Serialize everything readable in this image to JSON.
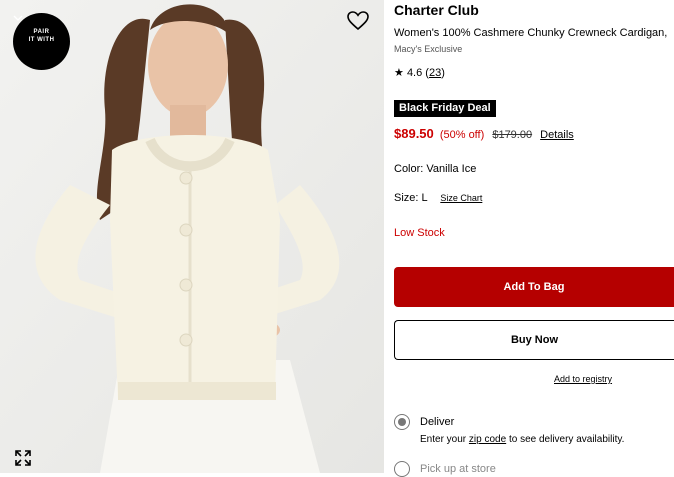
{
  "pair_badge": {
    "line1": "PAIR",
    "line2": "IT WITH"
  },
  "icons": {
    "heart": "heart-outline-icon",
    "expand": "expand-icon",
    "chevron": "chevron-down-icon",
    "star": "star-icon"
  },
  "product": {
    "brand": "Charter Club",
    "name": "Women's 100% Cashmere Chunky Crewneck Cardigan,",
    "exclusive": "Macy's Exclusive",
    "rating": "4.6",
    "review_count": "23",
    "deal_badge": "Black Friday Deal",
    "sale_price": "$89.50",
    "discount": "(50% off)",
    "original_price": "$179.00",
    "details_link": "Details",
    "color_label": "Color:",
    "color_value": "Vanilla Ice",
    "size_label": "Size:",
    "size_value": "L",
    "size_chart_link": "Size Chart",
    "stock_status": "Low Stock"
  },
  "actions": {
    "add_to_bag": "Add To Bag",
    "buy_now": "Buy Now",
    "add_to_registry": "Add to registry"
  },
  "fulfillment": {
    "deliver_label": "Deliver",
    "deliver_selected": true,
    "deliver_sub_prefix": "Enter your",
    "zip_link": "zip code",
    "deliver_sub_suffix": "to see delivery availability.",
    "pickup_label": "Pick up at store",
    "pickup_selected": false
  },
  "colors": {
    "accent_red": "#cc0000",
    "add_button": "#b50000",
    "badge_bg": "#000000"
  }
}
